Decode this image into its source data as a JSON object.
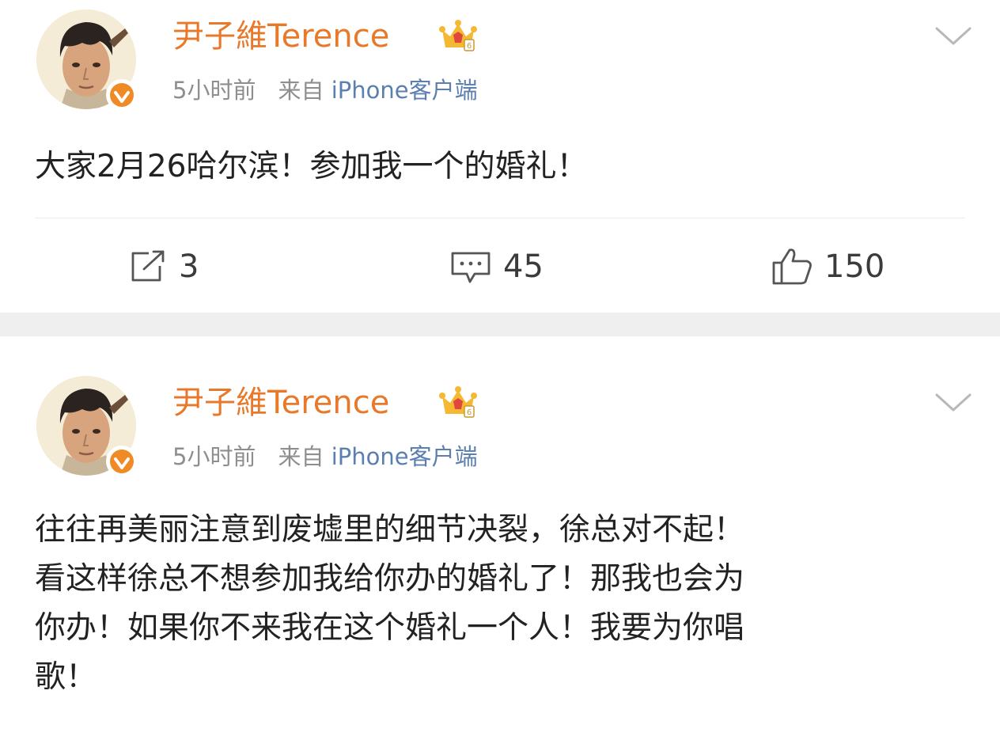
{
  "posts": [
    {
      "username": "尹子維Terence",
      "time": "5小时前",
      "source_prefix": "来自",
      "source": "iPhone客户端",
      "content_lines": [
        "大家2月26哈尔滨！参加我一个的婚礼！"
      ],
      "actions": {
        "repost": "3",
        "comment": "45",
        "like": "150"
      }
    },
    {
      "username": "尹子維Terence",
      "time": "5小时前",
      "source_prefix": "来自",
      "source": "iPhone客户端",
      "content_lines": [
        "往往再美丽注意到废墟里的细节决裂，徐总对不起！",
        "看这样徐总不想参加我给你办的婚礼了！那我也会为",
        "你办！如果你不来我在这个婚礼一个人！我要为你唱",
        "歌！"
      ]
    }
  ],
  "icons": {
    "avatar": "avatar-photo",
    "verified": "verified-badge-icon",
    "crown": "vip-crown-icon",
    "chevron": "chevron-down-icon",
    "repost": "repost-icon",
    "comment": "comment-icon",
    "like": "thumbs-up-icon"
  },
  "colors": {
    "username": "#e8792a",
    "meta_text": "#8e8e8e",
    "source_link": "#5a7fb0",
    "verified_badge": "#f08a24",
    "divider_band": "#efefef"
  }
}
